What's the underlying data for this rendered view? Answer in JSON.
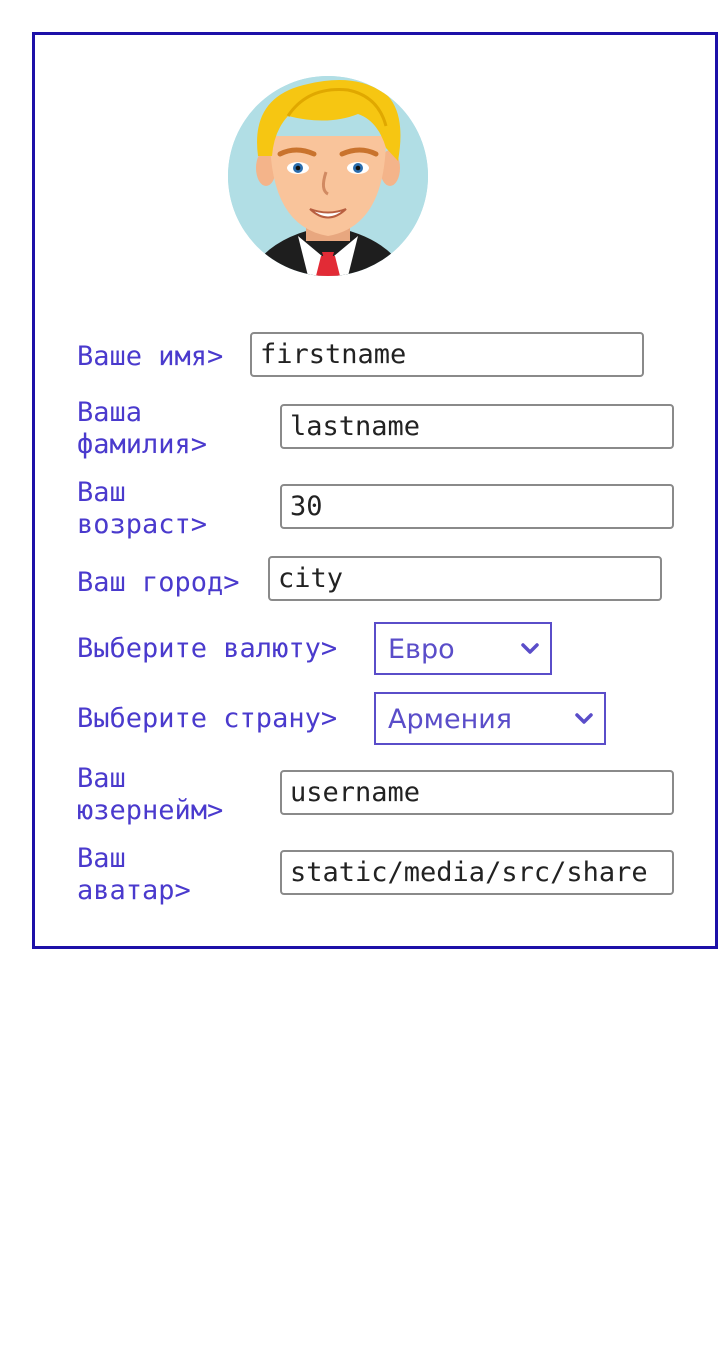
{
  "profile": {
    "avatar_icon": "user-avatar-illustration",
    "fields": {
      "firstname": {
        "label": "Ваше имя>",
        "value": "firstname"
      },
      "lastname": {
        "label_line1": "Ваша",
        "label_line2": "фамилия>",
        "value": "lastname"
      },
      "age": {
        "label_line1": "Ваш",
        "label_line2": "возраст>",
        "value": "30"
      },
      "city": {
        "label": "Ваш город>",
        "value": "city"
      },
      "currency": {
        "label": "Выберите валюту>",
        "selected": "Евро"
      },
      "country": {
        "label": "Выберите страну>",
        "selected": "Армения"
      },
      "username": {
        "label_line1": "Ваш",
        "label_line2": "юзернейм>",
        "value": "username"
      },
      "avatar": {
        "label_line1": "Ваш",
        "label_line2": "аватар>",
        "value": "static/media/src/share"
      }
    }
  },
  "colors": {
    "border": "#1d10a8",
    "label": "#4a3acd",
    "select": "#5a4dc9"
  }
}
